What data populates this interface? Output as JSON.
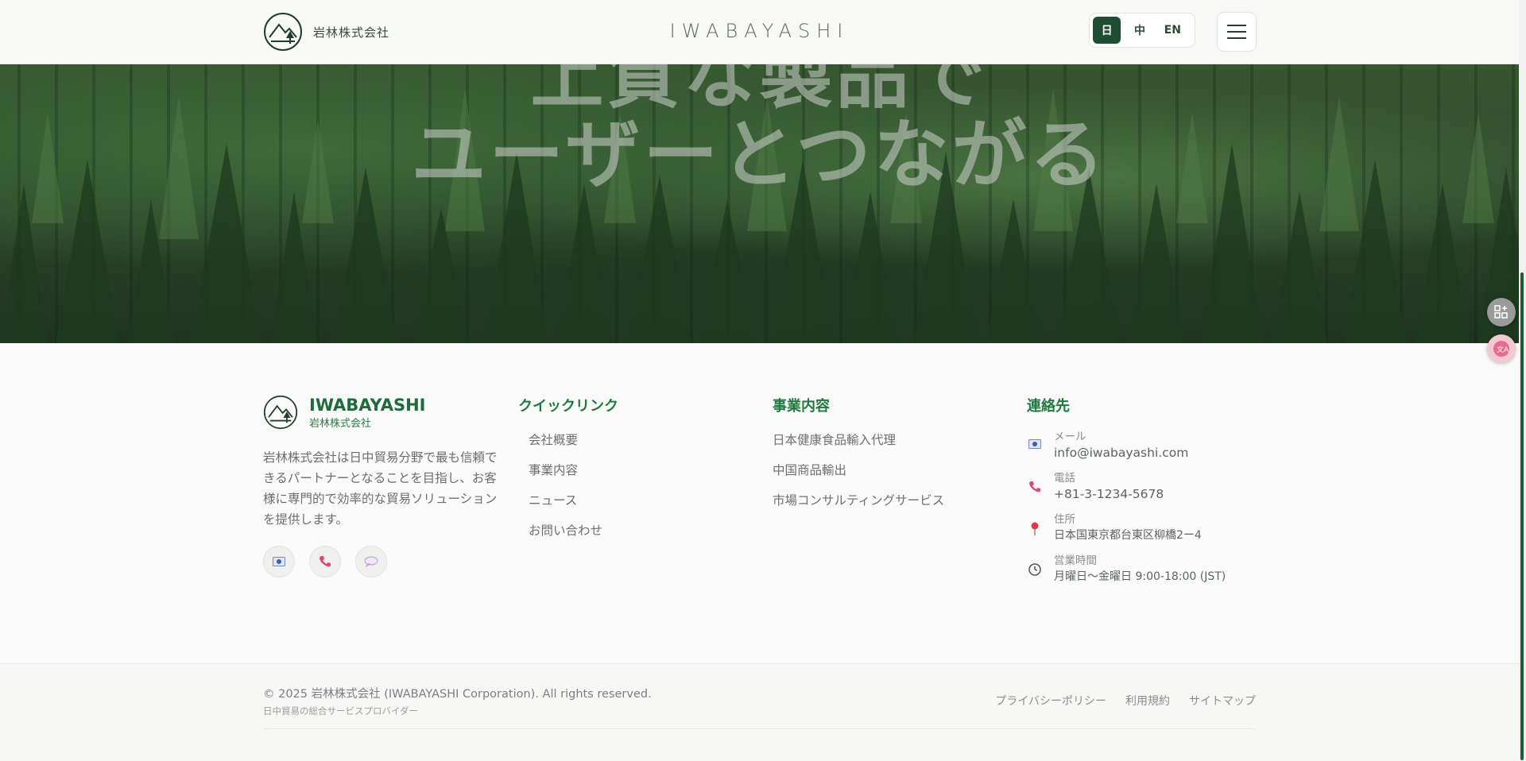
{
  "header": {
    "brand_text": "岩林株式会社",
    "wordmark": "IWABAYASHI",
    "languages": [
      {
        "label": "日",
        "active": true
      },
      {
        "label": "中",
        "active": false
      },
      {
        "label": "EN",
        "active": false
      }
    ]
  },
  "hero": {
    "line1": "上質な製品で",
    "line2": "ユーザーとつながる"
  },
  "footer": {
    "logo_name": "IWABAYASHI",
    "logo_sub": "岩林株式会社",
    "description": "岩林株式会社は日中貿易分野で最も信頼できるパートナーとなることを目指し、お客様に専門的で効率的な貿易ソリューションを提供します。",
    "quick_links": {
      "title": "クイックリンク",
      "items": [
        "会社概要",
        "事業内容",
        "ニュース",
        "お問い合わせ"
      ]
    },
    "services": {
      "title": "事業内容",
      "items": [
        "日本健康食品輸入代理",
        "中国商品輸出",
        "市場コンサルティングサービス"
      ]
    },
    "contact": {
      "title": "連絡先",
      "email_label": "メール",
      "email": "info@iwabayashi.com",
      "phone_label": "電話",
      "phone": "+81-3-1234-5678",
      "address_label": "住所",
      "address": "日本国東京都台東区柳橋2ー4",
      "hours_label": "営業時間",
      "hours": "月曜日〜金曜日 9:00-18:00 (JST)"
    },
    "copyright": "© 2025 岩林株式会社 (IWABAYASHI Corporation). All rights reserved.",
    "tagline": "日中貿易の総合サービスプロバイダー",
    "legal_links": [
      "プライバシーポリシー",
      "利用規約",
      "サイトマップ"
    ]
  },
  "colors": {
    "brand_green": "#1e4d33",
    "title_green": "#1f7a3d",
    "phone_pink": "#e0457b"
  }
}
